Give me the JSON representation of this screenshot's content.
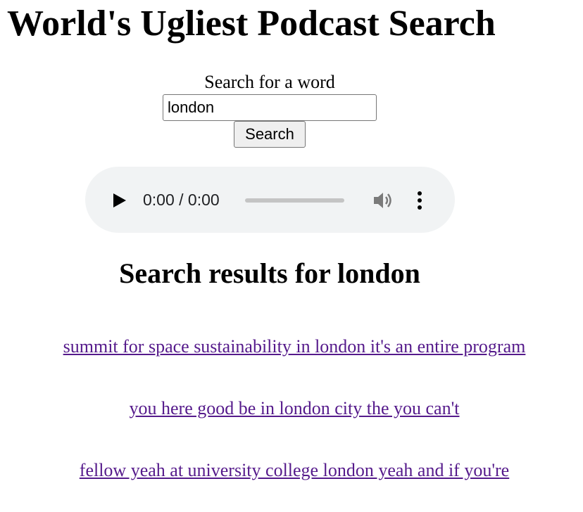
{
  "page": {
    "title": "World's Ugliest Podcast Search"
  },
  "search": {
    "label": "Search for a word",
    "value": "london",
    "button_label": "Search"
  },
  "audio": {
    "time": "0:00 / 0:00",
    "progress": 0
  },
  "results": {
    "heading": "Search results for london",
    "items": [
      "summit for space sustainability in london it's an entire program",
      "you here good be in london city the you can't",
      "fellow yeah at university college london yeah and if you're"
    ]
  },
  "colors": {
    "link": "#551a8b",
    "player_bg": "#f1f3f4"
  }
}
